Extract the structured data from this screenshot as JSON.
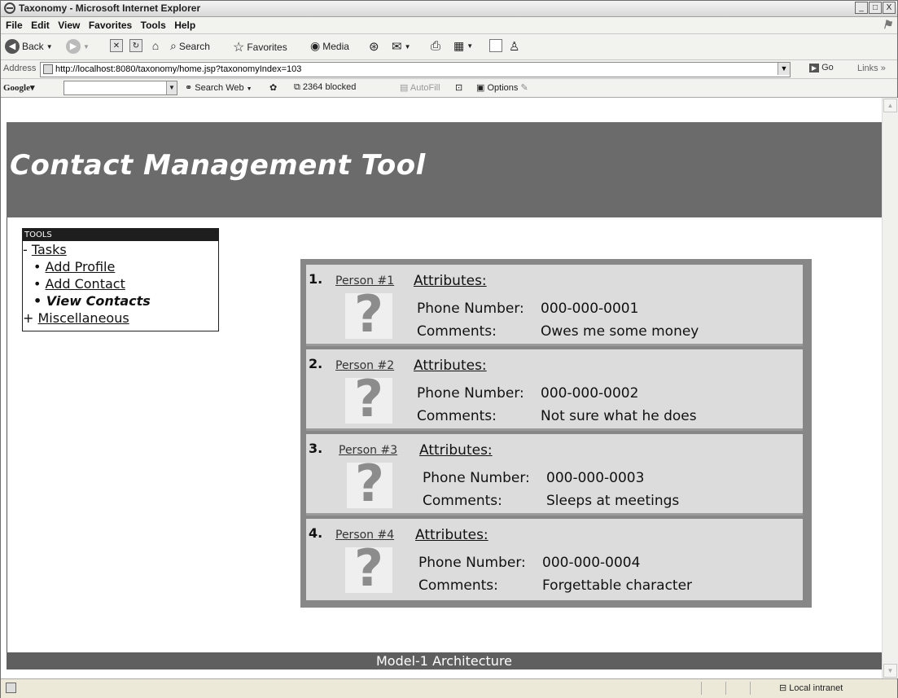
{
  "window": {
    "title": "Taxonomy - Microsoft Internet Explorer",
    "controls": [
      "_",
      "□",
      "X"
    ]
  },
  "menu": [
    "File",
    "Edit",
    "View",
    "Favorites",
    "Tools",
    "Help"
  ],
  "toolbar": {
    "back": "Back",
    "search": "Search",
    "favorites": "Favorites",
    "media": "Media"
  },
  "address": {
    "label": "Address",
    "url": "http://localhost:8080/taxonomy/home.jsp?taxonomyIndex=103",
    "go": "Go",
    "links": "Links"
  },
  "google": {
    "logo": "Google",
    "search_web": "Search Web",
    "blocked": "2364 blocked",
    "autofill": "AutoFill",
    "options": "Options"
  },
  "page": {
    "header_title": "Contact Management Tool",
    "tools": {
      "header": "TOOLS",
      "tasks_prefix": "-",
      "tasks": "Tasks",
      "items": [
        "Add Profile",
        "Add Contact",
        "View Contacts"
      ],
      "misc_prefix": "+",
      "misc": "Miscellaneous"
    },
    "contacts": [
      {
        "num": "1.",
        "name": "Person #1",
        "attributes": "Attributes:",
        "phone_label": "Phone Number:",
        "phone": "000-000-0001",
        "comments_label": "Comments:",
        "comments": "Owes me some money"
      },
      {
        "num": "2.",
        "name": "Person #2",
        "attributes": "Attributes:",
        "phone_label": "Phone Number:",
        "phone": "000-000-0002",
        "comments_label": "Comments:",
        "comments": "Not sure what he does"
      },
      {
        "num": "3.",
        "name": "Person #3",
        "attributes": "Attributes:",
        "phone_label": "Phone Number:",
        "phone": "000-000-0003",
        "comments_label": "Comments:",
        "comments": "Sleeps at meetings"
      },
      {
        "num": "4.",
        "name": "Person #4",
        "attributes": "Attributes:",
        "phone_label": "Phone Number:",
        "phone": "000-000-0004",
        "comments_label": "Comments:",
        "comments": "Forgettable character"
      }
    ],
    "footer": "Model-1 Architecture"
  },
  "status": {
    "zone": "Local intranet"
  }
}
